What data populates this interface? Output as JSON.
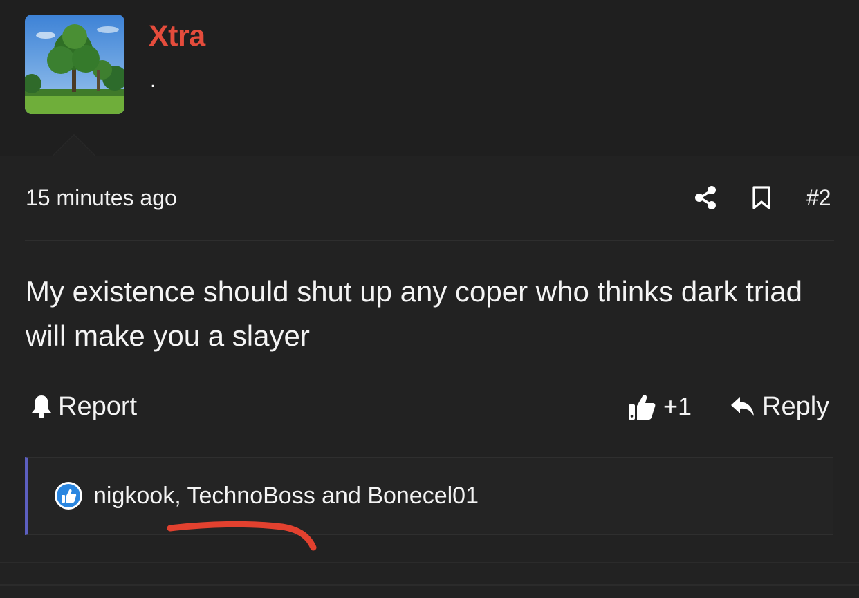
{
  "user": {
    "name": "Xtra",
    "title": "."
  },
  "post": {
    "timestamp": "15 minutes ago",
    "number": "#2",
    "body": "My existence should shut up any coper who thinks dark triad will make you a slayer"
  },
  "actions": {
    "report_label": "Report",
    "like_count": "+1",
    "reply_label": "Reply"
  },
  "reactions": {
    "users_text": "nigkook, TechnoBoss and Bonecel01"
  },
  "icons": {
    "avatar": "tree-landscape-photo",
    "share": "share-icon",
    "bookmark": "bookmark-icon",
    "report": "bell-icon",
    "like": "thumbs-up-icon",
    "reply": "reply-arrow-icon",
    "reaction": "thumbs-up-badge-icon"
  },
  "colors": {
    "background": "#222222",
    "username": "#e44c3c",
    "reaction_accent": "#5c5fc0",
    "annotation": "#e2412f"
  }
}
